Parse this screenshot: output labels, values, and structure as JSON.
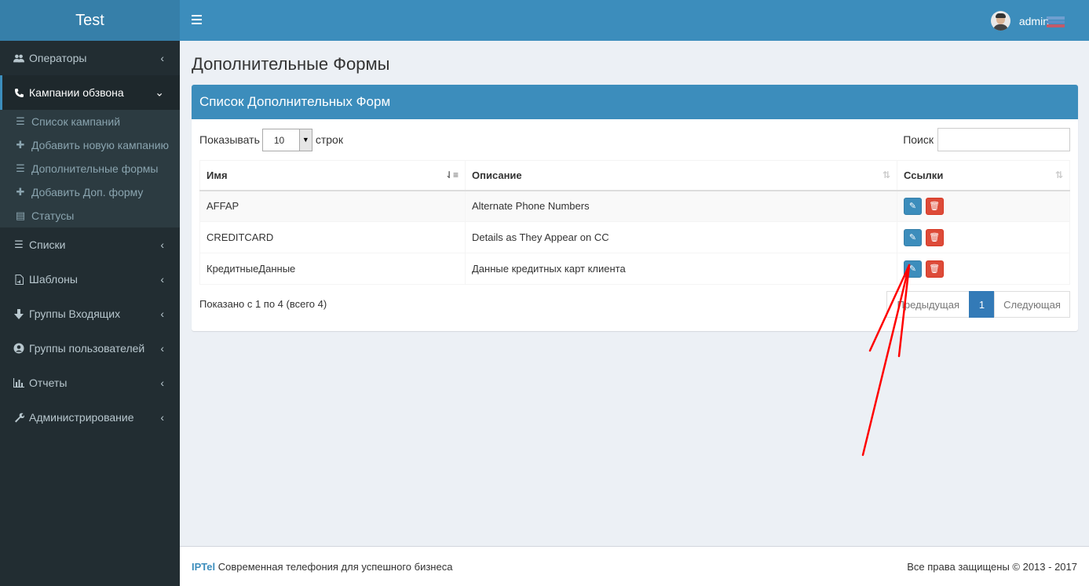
{
  "sidebar": {
    "logo": "Test",
    "items": [
      {
        "label": "Операторы",
        "icon": "users-icon"
      },
      {
        "label": "Кампании обзвона",
        "icon": "phone-icon"
      },
      {
        "label": "Списки",
        "icon": "list-icon"
      },
      {
        "label": "Шаблоны",
        "icon": "file-audio-icon"
      },
      {
        "label": "Группы Входящих",
        "icon": "arrow-down-icon"
      },
      {
        "label": "Группы пользователей",
        "icon": "user-circle-icon"
      },
      {
        "label": "Отчеты",
        "icon": "bar-chart-icon"
      },
      {
        "label": "Администрирование",
        "icon": "wrench-icon"
      }
    ],
    "submenu": [
      {
        "label": "Список кампаний",
        "icon": "list-icon"
      },
      {
        "label": "Добавить новую кампанию",
        "icon": "plus-icon"
      },
      {
        "label": "Дополнительные формы",
        "icon": "list-icon"
      },
      {
        "label": "Добавить Доп. форму",
        "icon": "plus-icon"
      },
      {
        "label": "Статусы",
        "icon": "table-icon"
      }
    ]
  },
  "header": {
    "user": "admin"
  },
  "page": {
    "title": "Дополнительные Формы",
    "box_title": "Список Дополнительных Форм",
    "show_label": "Показывать",
    "rows_value": "10",
    "rows_label": "строк",
    "search_label": "Поиск"
  },
  "table": {
    "columns": [
      "Имя",
      "Описание",
      "Ссылки"
    ],
    "rows": [
      {
        "name": "AFFAP",
        "description": "Alternate Phone Numbers"
      },
      {
        "name": "CREDITCARD",
        "description": "Details as They Appear on CC"
      },
      {
        "name": "КредитныеДанные",
        "description": "Данные кредитных карт клиента"
      }
    ]
  },
  "pagination": {
    "info": "Показано с 1 по 4 (всего 4)",
    "prev": "Предыдущая",
    "current": "1",
    "next": "Следующая"
  },
  "footer": {
    "brand": "IPTel",
    "tagline": " Современная телефония для успешного бизнеса",
    "copyright": "Все права защищены © 2013 - 2017"
  },
  "colors": {
    "header": "#3c8dbc",
    "sidebar": "#222d32",
    "delete": "#dd4b39",
    "annotation": "#ff0000"
  }
}
